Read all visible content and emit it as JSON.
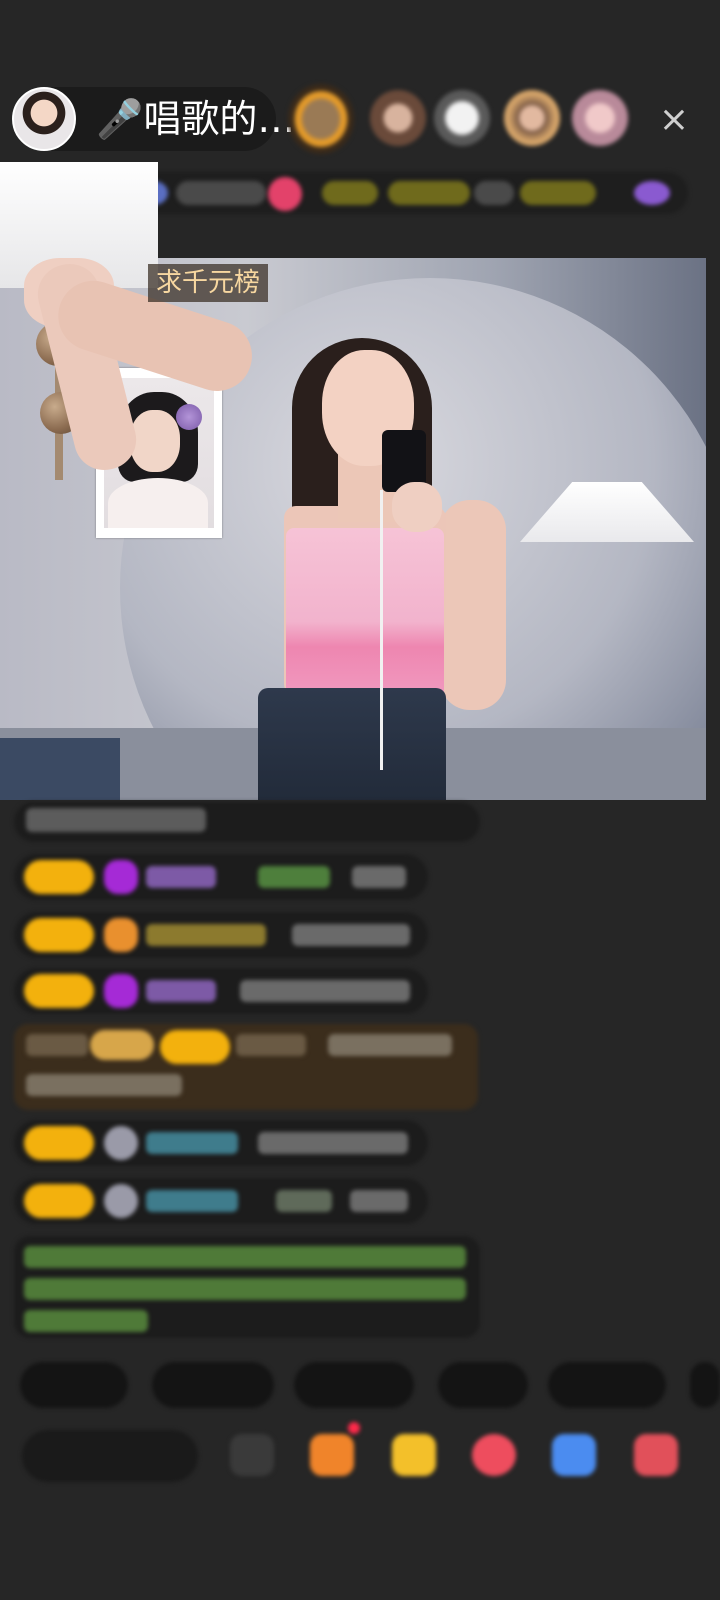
{
  "header": {
    "host_title": "🎤唱歌的…",
    "close_icon": "×"
  },
  "video": {
    "banner": "求千元榜"
  },
  "colors": {
    "background": "#262626",
    "badge": "#f3b10d",
    "banner_text": "#f7d7a0"
  }
}
